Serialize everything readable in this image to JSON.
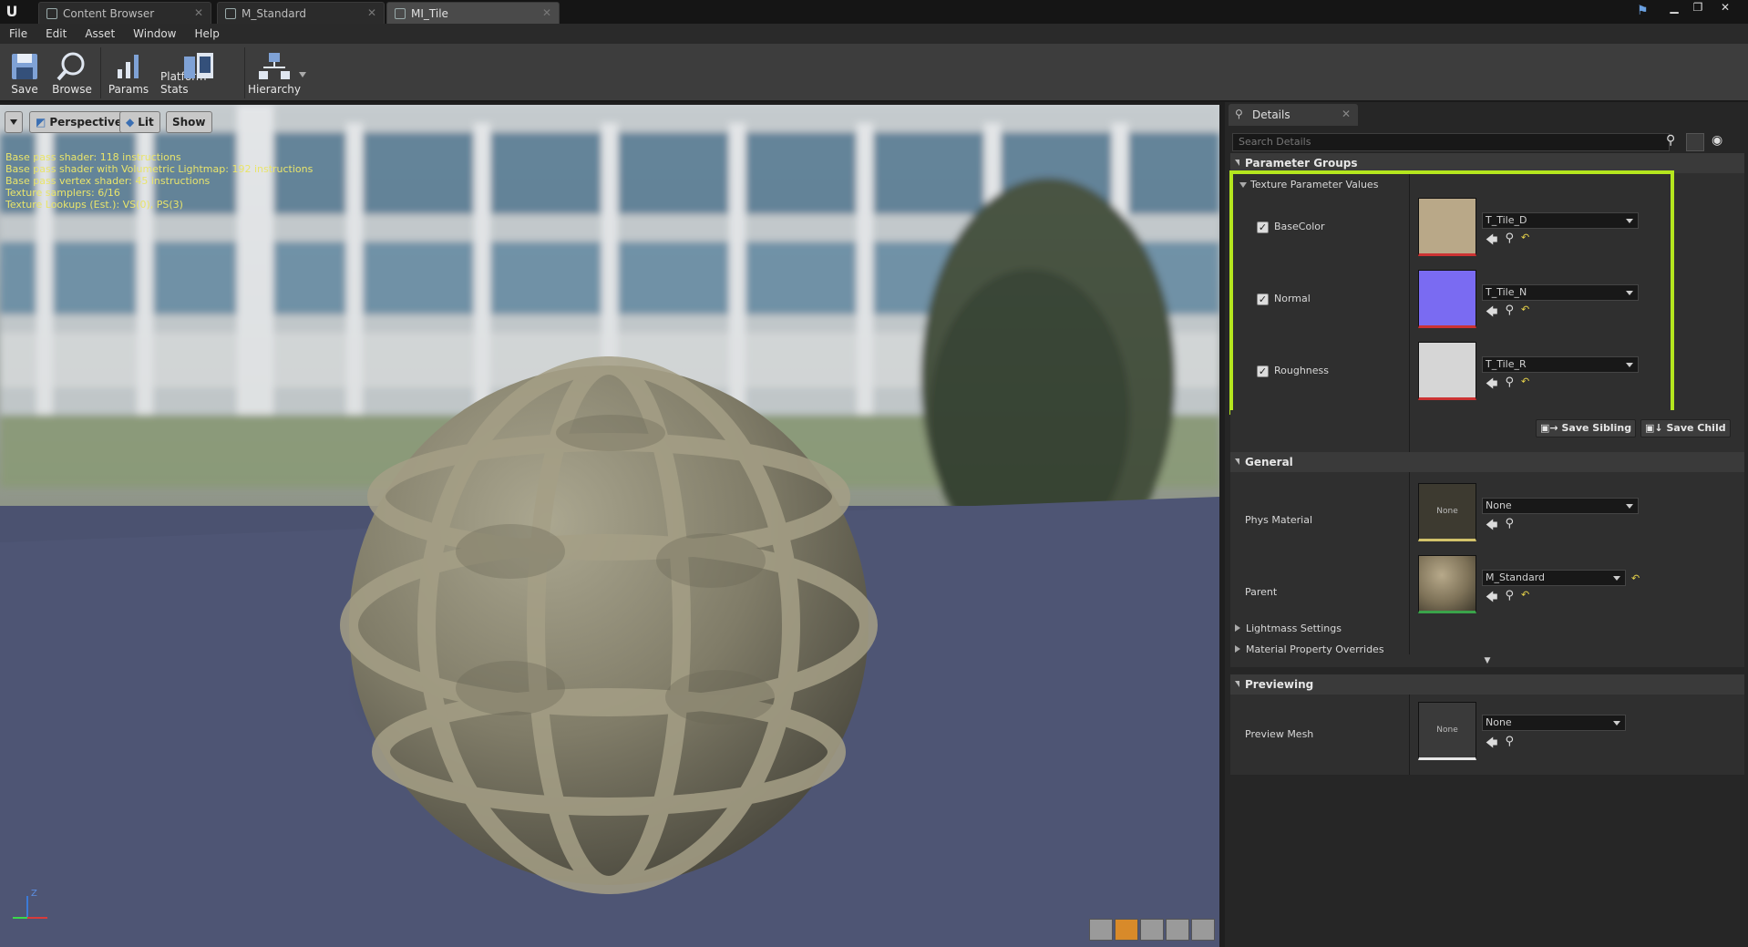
{
  "tabs": [
    {
      "label": "Content Browser",
      "active": false
    },
    {
      "label": "M_Standard",
      "active": false
    },
    {
      "label": "MI_Tile",
      "active": true
    }
  ],
  "menu": [
    "File",
    "Edit",
    "Asset",
    "Window",
    "Help"
  ],
  "toolbar": {
    "save": "Save",
    "browse": "Browse",
    "params": "Params",
    "platform_stats": "Platform Stats",
    "hierarchy": "Hierarchy"
  },
  "viewport": {
    "perspective": "Perspective",
    "lit": "Lit",
    "show": "Show",
    "stats": [
      "Base pass shader: 118 instructions",
      "Base pass shader with Volumetric Lightmap: 192 instructions",
      "Base pass vertex shader: 45 instructions",
      "Texture samplers: 6/16",
      "Texture Lookups (Est.): VS(0), PS(3)"
    ],
    "axis_z": "Z"
  },
  "details": {
    "tab_label": "Details",
    "search_placeholder": "Search Details",
    "param_groups_title": "Parameter Groups",
    "texture_group_label": "Texture Parameter Values",
    "params": [
      {
        "name": "BaseColor",
        "checked": true,
        "value": "T_Tile_D"
      },
      {
        "name": "Normal",
        "checked": true,
        "value": "T_Tile_N"
      },
      {
        "name": "Roughness",
        "checked": true,
        "value": "T_Tile_R"
      }
    ],
    "save_sibling": "Save Sibling",
    "save_child": "Save Child",
    "general_title": "General",
    "phys_material_label": "Phys Material",
    "phys_material_value": "None",
    "phys_thumb_text": "None",
    "parent_label": "Parent",
    "parent_value": "M_Standard",
    "lightmass_label": "Lightmass Settings",
    "overrides_label": "Material Property Overrides",
    "previewing_title": "Previewing",
    "preview_mesh_label": "Preview Mesh",
    "preview_mesh_value": "None",
    "preview_thumb_text": "None"
  },
  "colors": {
    "highlight": "#b4e61e",
    "basecolor_thumb": "#b9a888",
    "normal_thumb": "#7a6bf2",
    "roughness_thumb": "#d6d6d6"
  }
}
